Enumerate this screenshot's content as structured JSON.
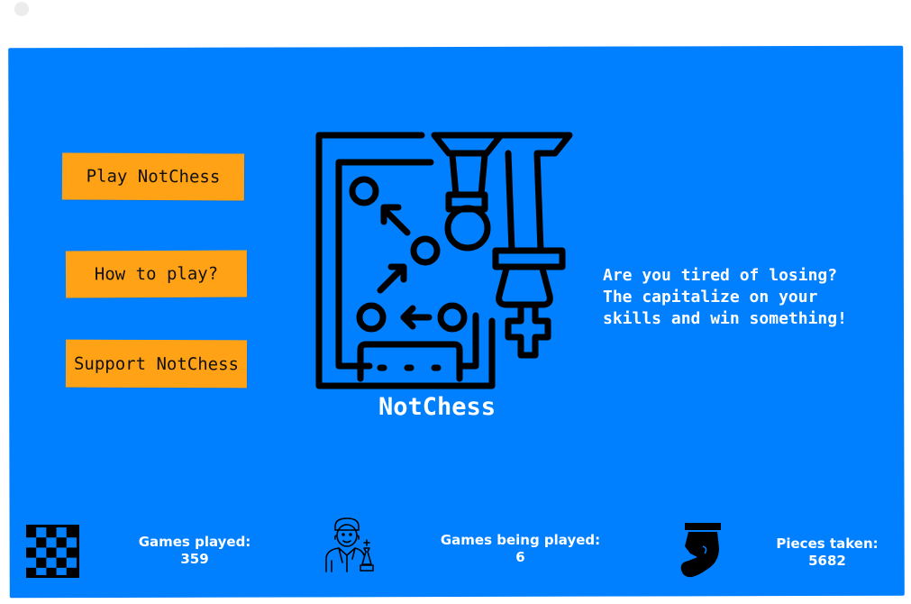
{
  "menu": {
    "play_label": "Play NotChess",
    "how_label": "How to play?",
    "support_label": "Support NotChess"
  },
  "brand": {
    "name": "NotChess",
    "logo_icon": "chess-strategy-board-icon"
  },
  "tagline": {
    "line1": "Are you tired of losing?",
    "line2": "The capitalize on your",
    "line3": "skills and win something!"
  },
  "stats": {
    "games_played": {
      "label": "Games played:",
      "value": "359",
      "icon": "checkerboard-icon"
    },
    "games_being_played": {
      "label": "Games being played:",
      "value": "6",
      "icon": "chess-player-icon"
    },
    "pieces_taken": {
      "label": "Pieces taken:",
      "value": "5682",
      "icon": "fallen-pawn-icon"
    }
  },
  "colors": {
    "background": "#0080ff",
    "button": "#ffa216",
    "text_light": "#ffffff",
    "text_dark": "#111111"
  }
}
